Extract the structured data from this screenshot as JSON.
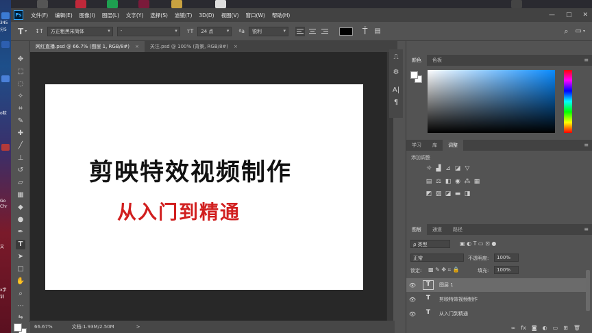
{
  "app": {
    "logo": "Ps",
    "menu": [
      "文件(F)",
      "编辑(E)",
      "图像(I)",
      "图层(L)",
      "文字(Y)",
      "选择(S)",
      "滤镜(T)",
      "3D(D)",
      "视图(V)",
      "窗口(W)",
      "帮助(H)"
    ],
    "window_controls": [
      "—",
      "□",
      "✕"
    ]
  },
  "options_bar": {
    "tool_icon": "T",
    "orient_icon": "↕T",
    "font_family": "方正粗黑宋简体",
    "font_style": "-",
    "size_icon": "тT",
    "font_size": "24 点",
    "aa_icon": "ªa",
    "antialias": "锐利",
    "text_color": "#000000"
  },
  "tabs": [
    {
      "label": "网红直播.psd @ 66.7% (图层 1, RGB/8#)",
      "close": "×"
    },
    {
      "label": "关注.psd @ 100% (背景, RGB/8#)",
      "close": "×"
    }
  ],
  "canvas": {
    "title": "剪映特效视频制作",
    "subtitle": "从入门到精通"
  },
  "status": {
    "zoom": "66.67%",
    "doc": "文档:1.93M/2.50M",
    "arrow": ">"
  },
  "panels": {
    "color_tabs": [
      "颜色",
      "色板"
    ],
    "adjust_tabs": [
      "学习",
      "库",
      "调整"
    ],
    "adjust_heading": "添加调整",
    "layers_tabs": [
      "图层",
      "通道",
      "路径"
    ],
    "filter_kind": "ρ 类型",
    "blend_mode": "正常",
    "opacity_label": "不透明度:",
    "opacity": "100%",
    "lock_label": "锁定:",
    "fill_label": "填充:",
    "fill": "100%",
    "layers": [
      {
        "name": "图层 1",
        "selected": true
      },
      {
        "name": "剪映特效视频制作",
        "selected": false
      },
      {
        "name": "从入门到精通",
        "selected": false
      }
    ]
  },
  "desktop_fragments": [
    "345",
    "分5",
    "o软",
    "Go",
    "Chr",
    "文",
    "x学",
    "训"
  ]
}
